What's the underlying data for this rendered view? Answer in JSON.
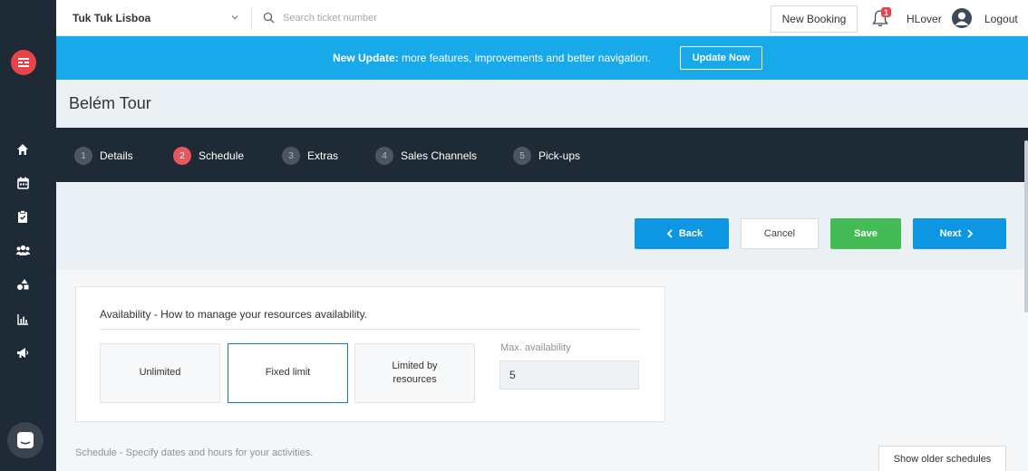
{
  "topbar": {
    "company": "Tuk Tuk Lisboa",
    "search_placeholder": "Search ticket number",
    "new_booking": "New Booking",
    "notification_count": "1",
    "username": "HLover",
    "logout": "Logout"
  },
  "banner": {
    "bold": "New Update:",
    "text": " more features, improvements and better navigation.",
    "button": "Update Now"
  },
  "page": {
    "title": "Belém Tour"
  },
  "stepper": {
    "steps": [
      {
        "num": "1",
        "label": "Details"
      },
      {
        "num": "2",
        "label": "Schedule"
      },
      {
        "num": "3",
        "label": "Extras"
      },
      {
        "num": "4",
        "label": "Sales Channels"
      },
      {
        "num": "5",
        "label": "Pick-ups"
      }
    ],
    "active_step": "2"
  },
  "actions": {
    "back": "Back",
    "cancel": "Cancel",
    "save": "Save",
    "next": "Next"
  },
  "availability": {
    "title": "Availability - How to manage your resources availability.",
    "options": [
      {
        "label": "Unlimited"
      },
      {
        "label": "Fixed limit"
      },
      {
        "label": "Limited by resources"
      }
    ],
    "selected": "Fixed limit",
    "max_label": "Max. availability",
    "max_value": "5"
  },
  "schedule": {
    "text": "Schedule - Specify dates and hours for your activities.",
    "older_button": "Show older schedules"
  },
  "colors": {
    "sidebar": "#1f2a37",
    "banner": "#17a9e9",
    "primary": "#0d96e3",
    "success": "#44bb54",
    "danger": "#e8434b"
  },
  "icons": {
    "sidebar": [
      "home-icon",
      "calendar-icon",
      "clipboard-icon",
      "users-icon",
      "shapes-icon",
      "chart-icon",
      "megaphone-icon"
    ]
  }
}
